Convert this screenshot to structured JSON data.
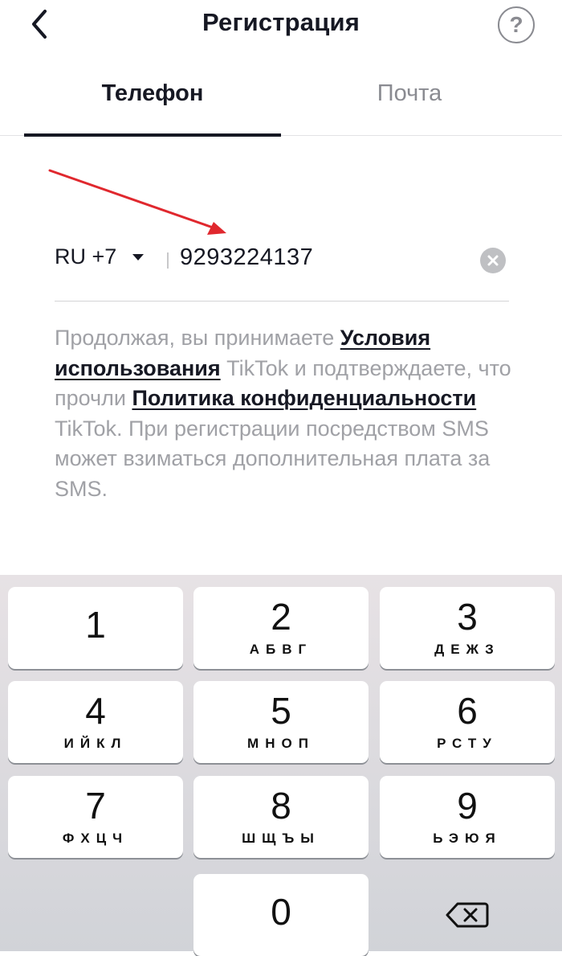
{
  "header": {
    "title": "Регистрация",
    "help_label": "?"
  },
  "tabs": [
    {
      "label": "Телефон",
      "active": true
    },
    {
      "label": "Почта",
      "active": false
    }
  ],
  "phone": {
    "country": "RU +7",
    "number": "9293224137"
  },
  "terms": {
    "part1": "Продолжая, вы принимаете ",
    "link1": "Условия использования",
    "part2": " TikTok и подтверждаете, что прочли ",
    "link2": "Политика конфиденциальности",
    "part3": " TikTok. При регистрации посредством SMS может взиматься дополнительная плата за SMS."
  },
  "keypad": {
    "keys": [
      {
        "digit": "1",
        "letters": ""
      },
      {
        "digit": "2",
        "letters": "АБВГ"
      },
      {
        "digit": "3",
        "letters": "ДЕЖЗ"
      },
      {
        "digit": "4",
        "letters": "ИЙКЛ"
      },
      {
        "digit": "5",
        "letters": "МНОП"
      },
      {
        "digit": "6",
        "letters": "РСТУ"
      },
      {
        "digit": "7",
        "letters": "ФХЦЧ"
      },
      {
        "digit": "8",
        "letters": "ШЩЪЫ"
      },
      {
        "digit": "9",
        "letters": "ЬЭЮЯ"
      },
      {
        "digit": "0",
        "letters": ""
      }
    ]
  },
  "colors": {
    "text": "#161823",
    "muted": "#a0a1a6",
    "annotation_arrow": "#e0282e"
  }
}
